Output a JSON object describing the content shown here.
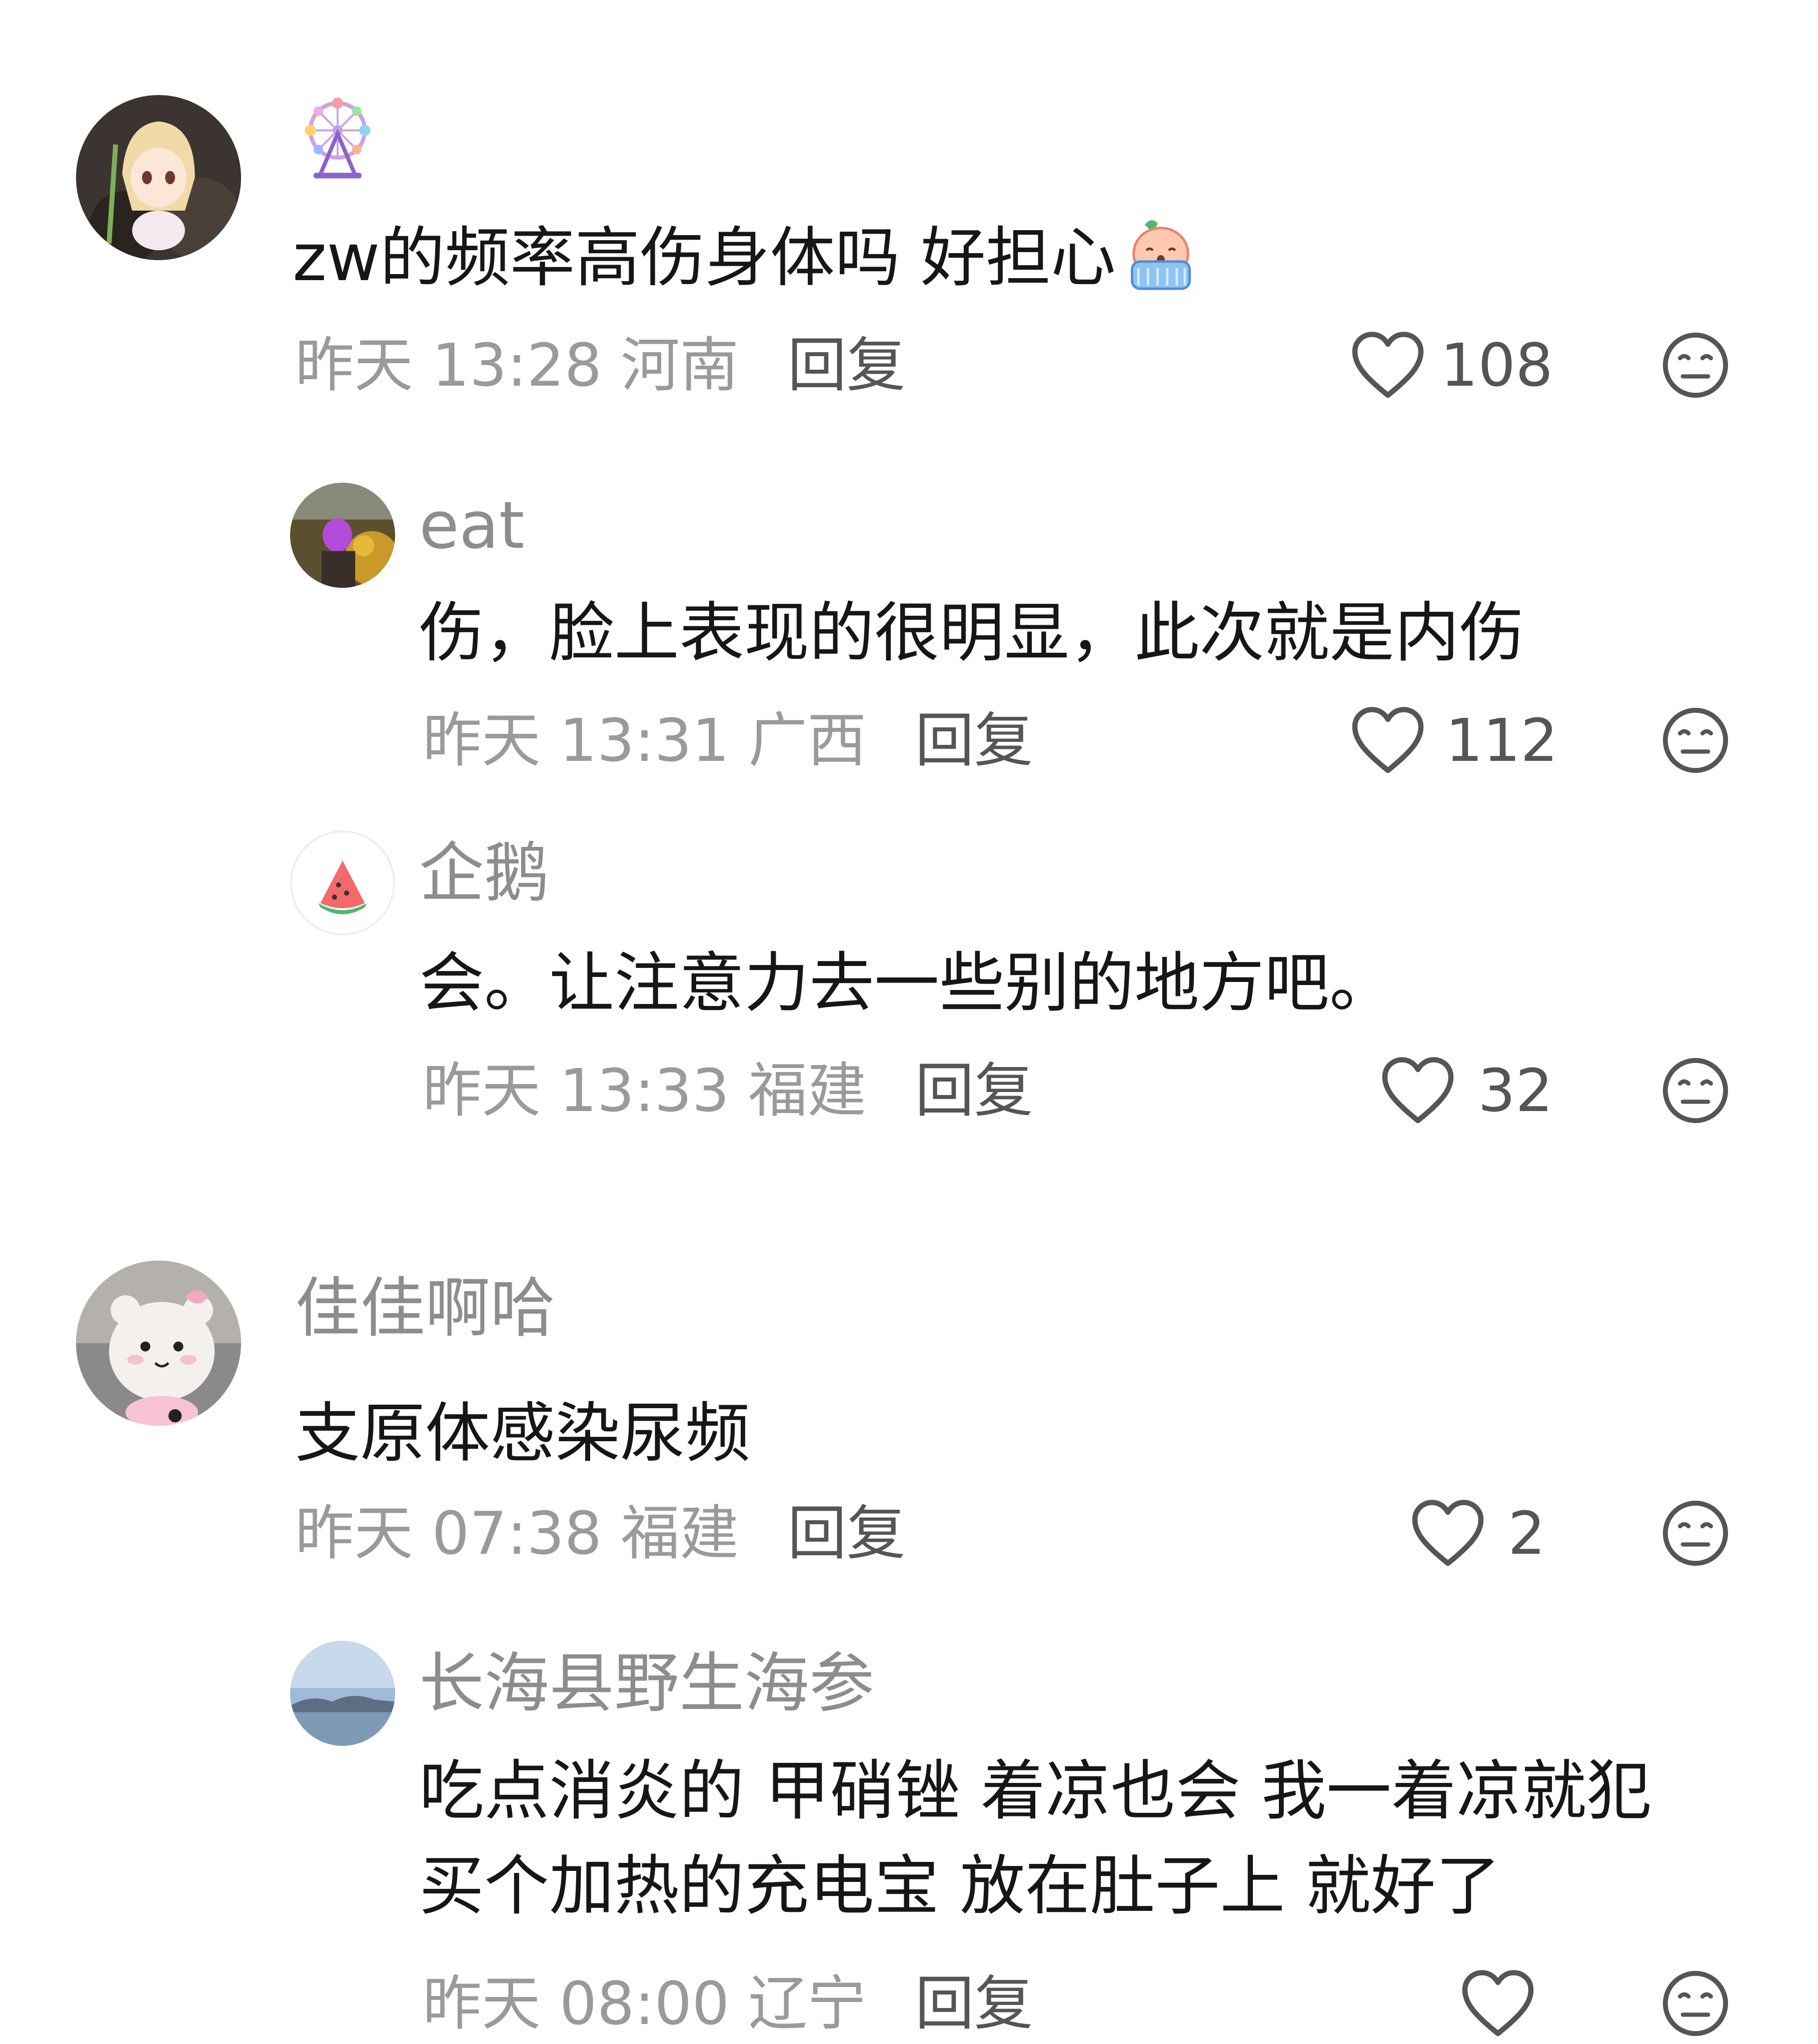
{
  "comments": [
    {
      "username": "",
      "username_icon": "ferris-wheel-icon",
      "text": "zw的频率高伤身体吗 好担心",
      "text_emoji": "crying-face-emoji",
      "meta_time": "昨天 13:28",
      "meta_location": "河南",
      "reply_label": "回复",
      "likes": "108",
      "replies": [
        {
          "username": "eat",
          "text": "伤，脸上表现的很明显，此次就是内伤",
          "meta_time": "昨天 13:31",
          "meta_location": "广西",
          "reply_label": "回复",
          "likes": "112"
        },
        {
          "username": "企鹅",
          "avatar_icon": "watermelon-icon",
          "text": "会。让注意力去一些别的地方吧。",
          "meta_time": "昨天 13:33",
          "meta_location": "福建",
          "reply_label": "回复",
          "likes": "32"
        }
      ]
    },
    {
      "username": "佳佳啊哈",
      "text": "支原体感染尿频",
      "meta_time": "昨天 07:38",
      "meta_location": "福建",
      "reply_label": "回复",
      "likes": "2",
      "replies": [
        {
          "username": "长海县野生海参",
          "text_line1": "吃点消炎的 甲硝锉 着凉也会 我一着凉就犯",
          "text_line2": "买个加热的充电宝 放在肚子上 就好了",
          "meta_time": "昨天 08:00",
          "meta_location": "辽宁",
          "reply_label": "回复",
          "likes": ""
        }
      ]
    }
  ],
  "colors": {
    "text": "#161616",
    "muted": "#9a9a9a",
    "icon": "#555555"
  }
}
